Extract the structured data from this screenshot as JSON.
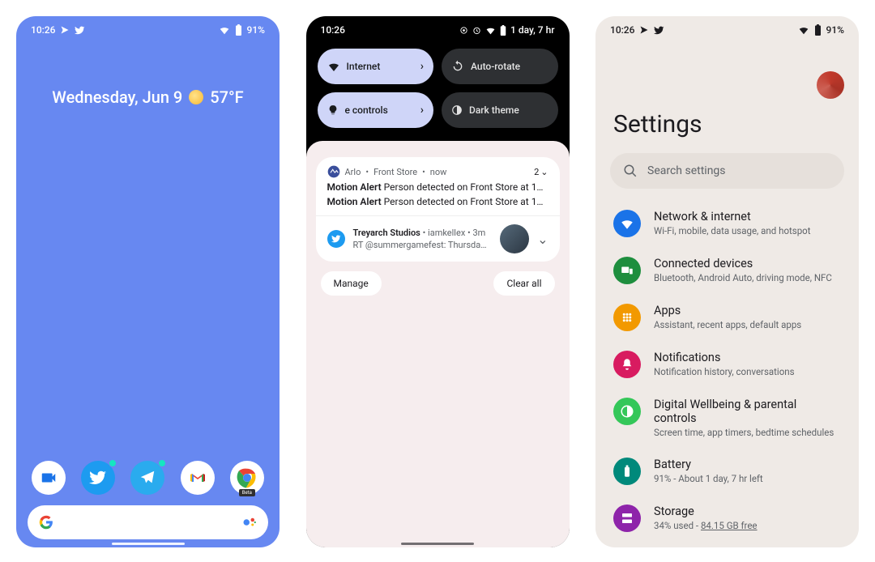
{
  "home": {
    "status": {
      "time": "10:26",
      "battery": "91%"
    },
    "weather": {
      "date": "Wednesday, Jun 9",
      "temp": "57°F"
    },
    "dock": {
      "duo": "duo-icon",
      "twitter": "twitter-icon",
      "telegram": "telegram-icon",
      "gmail": "gmail-icon",
      "chrome": "chrome-icon",
      "beta": "Beta"
    }
  },
  "shade": {
    "status": {
      "time": "10:26",
      "remaining": "1 day, 7 hr"
    },
    "qs": {
      "internet": "Internet",
      "auto_rotate": "Auto-rotate",
      "controls": "e controls",
      "dark_theme": "Dark theme"
    },
    "arlo": {
      "app": "Arlo",
      "source": "Front Store",
      "when": "now",
      "count": "2",
      "line1_title": "Motion Alert",
      "line1_body": "Person detected on Front Store at 1…",
      "line2_title": "Motion Alert",
      "line2_body": "Person detected on Front Store at 1…"
    },
    "tweet": {
      "title": "Treyarch Studios",
      "handle": "iamkellex",
      "when": "3m",
      "body": "RT @summergamefest: Thursda…"
    },
    "actions": {
      "manage": "Manage",
      "clear_all": "Clear all"
    }
  },
  "settings": {
    "status": {
      "time": "10:26",
      "battery": "91%"
    },
    "title": "Settings",
    "search_placeholder": "Search settings",
    "items": [
      {
        "title": "Network & internet",
        "sub": "Wi-Fi, mobile, data usage, and hotspot",
        "color": "bg-blue",
        "icon": "wifi-icon"
      },
      {
        "title": "Connected devices",
        "sub": "Bluetooth, Android Auto, driving mode, NFC",
        "color": "bg-green",
        "icon": "devices-icon"
      },
      {
        "title": "Apps",
        "sub": "Assistant, recent apps, default apps",
        "color": "bg-orange",
        "icon": "apps-icon"
      },
      {
        "title": "Notifications",
        "sub": "Notification history, conversations",
        "color": "bg-pink",
        "icon": "bell-icon"
      },
      {
        "title": "Digital Wellbeing & parental controls",
        "sub": "Screen time, app timers, bedtime schedules",
        "color": "bg-mint",
        "icon": "wellbeing-icon"
      },
      {
        "title": "Battery",
        "sub": "91% - About 1 day, 7 hr left",
        "color": "bg-teal",
        "icon": "battery-icon"
      },
      {
        "title": "Storage",
        "sub_plain": "34% used - ",
        "sub_ul": "84.15 GB free",
        "color": "bg-purple",
        "icon": "storage-icon"
      }
    ]
  }
}
